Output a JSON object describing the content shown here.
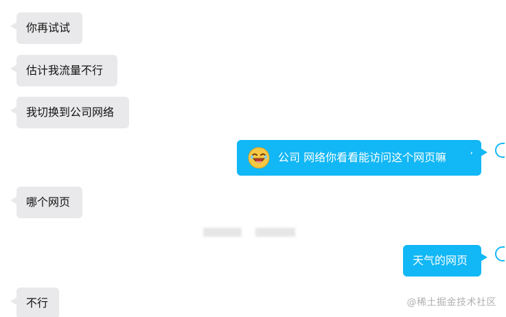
{
  "messages": [
    {
      "side": "in",
      "text": "你再试试"
    },
    {
      "side": "in",
      "text": "估计我流量不行"
    },
    {
      "side": "in",
      "text": "我切换到公司网络"
    },
    {
      "side": "out",
      "text": "公司  网络你看看能访问这个网页嘛",
      "emoji": "laughing-face-emoji"
    },
    {
      "side": "in",
      "text": "哪个网页"
    },
    {
      "side": "out",
      "text": "天气的网页"
    },
    {
      "side": "in",
      "text": "不行"
    }
  ],
  "watermark": "@稀土掘金技术社区",
  "colors": {
    "incoming_bubble": "#e9e9eb",
    "outgoing_bubble": "#12b7f5",
    "outgoing_text": "#ffffff",
    "watermark": "#b0b0b0"
  }
}
